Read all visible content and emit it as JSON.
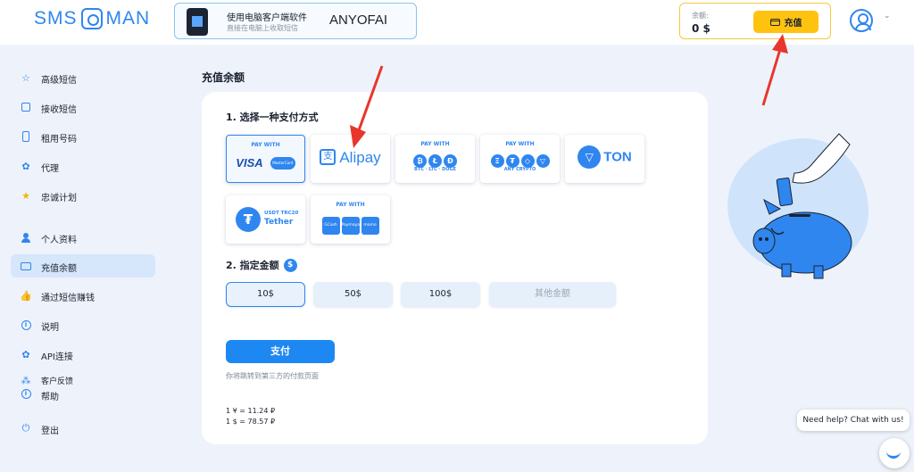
{
  "brand": {
    "logo_left": "SMS",
    "logo_right": "MAN"
  },
  "promo": {
    "title": "使用电脑客户端软件",
    "subtitle": "直接在电脑上收取短信",
    "code": "ANYOFAI"
  },
  "balance": {
    "label": "余额:",
    "amount": "0 $",
    "topup_label": "充值"
  },
  "sidebar": {
    "items": [
      {
        "label": "高级短信",
        "icon": "star-icon"
      },
      {
        "label": "接收短信",
        "icon": "mail-icon"
      },
      {
        "label": "租用号码",
        "icon": "phone-icon"
      },
      {
        "label": "代理",
        "icon": "gear-icon"
      },
      {
        "label": "忠诚计划",
        "icon": "star-filled-icon"
      },
      {
        "label": "个人资料",
        "icon": "user-icon"
      },
      {
        "label": "充值余额",
        "icon": "card-icon",
        "active": true
      },
      {
        "label": "通过短信赚钱",
        "icon": "thumbs-up-icon"
      },
      {
        "label": "说明",
        "icon": "info-icon"
      },
      {
        "label": "API连接",
        "icon": "gear-icon"
      },
      {
        "label": "客户反馈",
        "icon": "feedback-icon"
      },
      {
        "label": "帮助",
        "icon": "help-icon"
      },
      {
        "label": "登出",
        "icon": "power-icon"
      }
    ]
  },
  "main": {
    "title": "充值余额",
    "step1": "1. 选择一种支付方式",
    "step2": "2. 指定金额",
    "methods": {
      "visa": {
        "pay_with": "PAY WITH",
        "visa": "VISA",
        "mastercard": "MasterCard"
      },
      "alipay": {
        "text": "Alipay"
      },
      "crypto1": {
        "pay_with": "PAY WITH",
        "sub": "BTC · LTC · DOGE"
      },
      "crypto2": {
        "pay_with": "PAY WITH",
        "sub": "ANY CRYPTO"
      },
      "ton": {
        "text": "TON"
      },
      "tether": {
        "line1": "USDT TRC20",
        "line2": "Tether"
      },
      "wallets": {
        "pay_with": "PAY WITH",
        "w1": "GCash",
        "w2": "Paymaya",
        "w3": "momo"
      }
    },
    "amounts": [
      "10$",
      "50$",
      "100$"
    ],
    "other_amount": "其他金额",
    "pay_button": "支付",
    "redirect_note": "你将跳转到第三方的付款页面",
    "rate_cny": "1 ¥ = 11.24 ₽",
    "rate_usd": "1 $ = 78.57 ₽"
  },
  "chat": {
    "bubble": "Need help? Chat with us!"
  },
  "colors": {
    "accent": "#2f86ef",
    "topup": "#ffc30f",
    "arrow": "#e8362c"
  }
}
